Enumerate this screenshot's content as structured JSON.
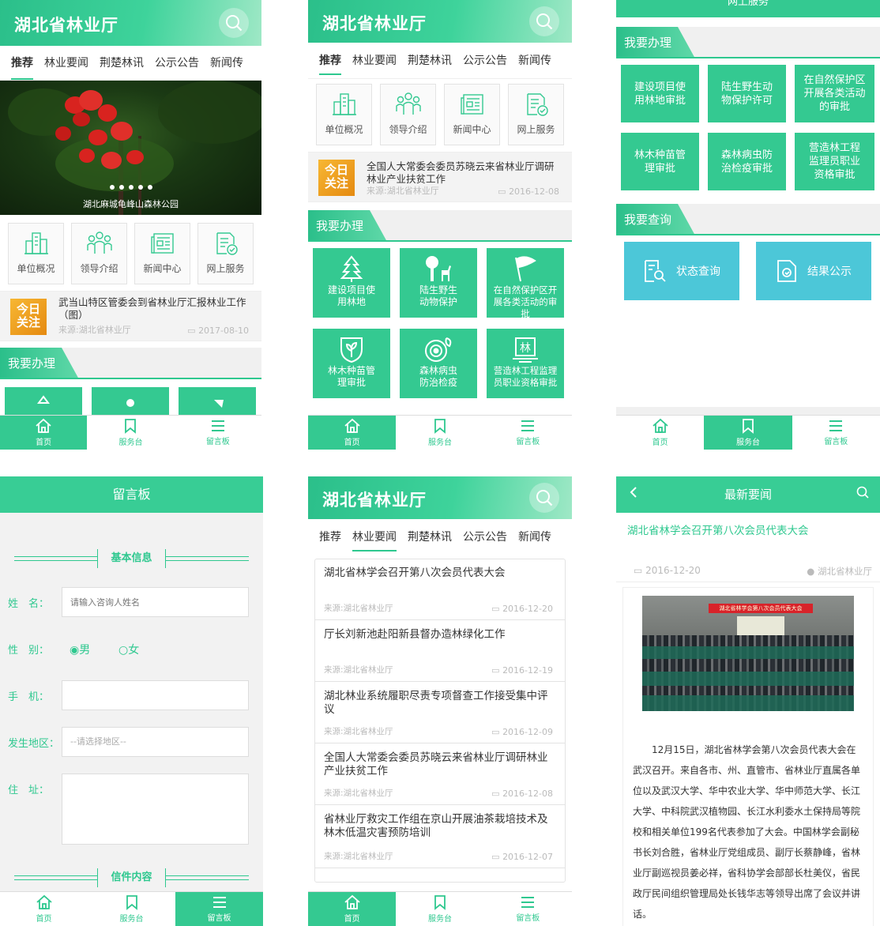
{
  "app_title": "湖北省林业厅",
  "tabs": [
    "推荐",
    "林业要闻",
    "荆楚林讯",
    "公示公告",
    "新闻传"
  ],
  "banner_caption": "湖北麻城龟峰山森林公园",
  "quick_links": [
    "单位概况",
    "领导介绍",
    "新闻中心",
    "网上服务"
  ],
  "today_badge": {
    "line1": "今日",
    "line2": "关注"
  },
  "screen1_notice": {
    "title": "武当山特区管委会到省林业厅汇报林业工作（图）",
    "source": "来源:湖北省林业厅",
    "date": "2017-08-10"
  },
  "screen2_notice": {
    "title": "全国人大常委会委员苏晓云来省林业厅调研林业产业扶贫工作",
    "source": "来源:湖北省林业厅",
    "date": "2016-12-08"
  },
  "section_handle": "我要办理",
  "section_query": "我要查询",
  "handle_tiles": [
    "建设项目使用林地",
    "陆生野生动物保护",
    "在自然保护区开展各类活动的审批",
    "林木种苗管理审批",
    "森林病虫防治检疫",
    "营造林工程监理员职业资格审批"
  ],
  "handle_tiles_long": [
    "建设项目使用林地审批",
    "陆生野生动物保护许可",
    "在自然保护区开展各类活动的审批",
    "林木种苗管理审批",
    "森林病虫防治检疫审批",
    "营造林工程监理员职业资格审批"
  ],
  "s3_top_label": "网上服务",
  "query_tiles": [
    "状态查询",
    "结果公示"
  ],
  "tabbar": [
    "首页",
    "服务台",
    "留言板"
  ],
  "message_board": {
    "title": "留言板",
    "section_basic": "基本信息",
    "section_letter": "信件内容",
    "fields": {
      "name_label": "姓　名：",
      "name_placeholder": "请输入咨询人姓名",
      "gender_label": "性　别：",
      "male": "男",
      "female": "女",
      "phone_label": "手　机：",
      "region_label": "发生地区：",
      "region_placeholder": "--请选择地区--",
      "address_label": "住　址："
    }
  },
  "news_list": [
    {
      "title": "湖北省林学会召开第八次会员代表大会",
      "source": "来源:湖北省林业厅",
      "date": "2016-12-20"
    },
    {
      "title": "厅长刘新池赴阳新县督办造林绿化工作",
      "source": "来源:湖北省林业厅",
      "date": "2016-12-19"
    },
    {
      "title": "湖北林业系统履职尽责专项督查工作接受集中评议",
      "source": "来源:湖北省林业厅",
      "date": "2016-12-09"
    },
    {
      "title": "全国人大常委会委员苏晓云来省林业厅调研林业产业扶贫工作",
      "source": "来源:湖北省林业厅",
      "date": "2016-12-08"
    },
    {
      "title": "省林业厅救灾工作组在京山开展油茶栽培技术及林木低温灾害预防培训",
      "source": "来源:湖北省林业厅",
      "date": "2016-12-07"
    }
  ],
  "article": {
    "header": "最新要闻",
    "title": "湖北省林学会召开第八次会员代表大会",
    "date": "2016-12-20",
    "source": "湖北省林业厅",
    "photo_banner": "湖北省林学会第八次会员代表大会",
    "body": "12月15日，湖北省林学会第八次会员代表大会在武汉召开。来自各市、州、直管市、省林业厅直属各单位以及武汉大学、华中农业大学、华中师范大学、长江大学、中科院武汉植物园、长江水利委水土保持局等院校和相关单位199名代表参加了大会。中国林学会副秘书长刘合胜，省林业厅党组成员、副厅长蔡静峰，省林业厅副巡视员姜必祥，省科协学会部部长杜美仪，省民政厅民间组织管理局处长钱华志等领导出席了会议并讲话。"
  },
  "colors": {
    "primary": "#34c991",
    "query": "#4cc7d8",
    "badge": "#f0a020"
  }
}
